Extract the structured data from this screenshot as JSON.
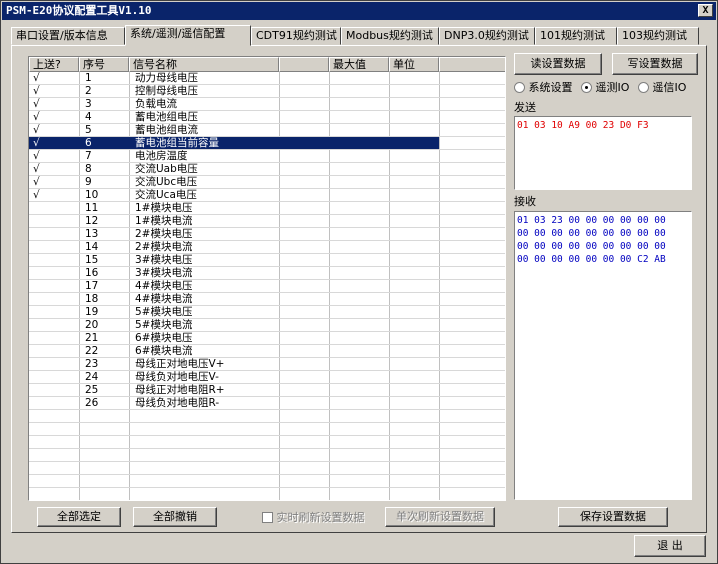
{
  "window": {
    "title": "PSM-E20协议配置工具V1.10",
    "close_label": "X"
  },
  "tabs": [
    {
      "label": "串口设置/版本信息"
    },
    {
      "label": "系统/遥测/遥信配置"
    },
    {
      "label": "CDT91规约测试"
    },
    {
      "label": "Modbus规约测试"
    },
    {
      "label": "DNP3.0规约测试"
    },
    {
      "label": "101规约测试"
    },
    {
      "label": "103规约测试"
    }
  ],
  "table": {
    "columns": [
      "上送?",
      "序号",
      "信号名称",
      "最大值",
      "单位"
    ],
    "rows": [
      {
        "sent": "√",
        "no": "1",
        "name": "动力母线电压"
      },
      {
        "sent": "√",
        "no": "2",
        "name": "控制母线电压"
      },
      {
        "sent": "√",
        "no": "3",
        "name": "负载电流"
      },
      {
        "sent": "√",
        "no": "4",
        "name": "蓄电池组电压"
      },
      {
        "sent": "√",
        "no": "5",
        "name": "蓄电池组电流"
      },
      {
        "sent": "√",
        "no": "6",
        "name": "蓄电池组当前容量"
      },
      {
        "sent": "√",
        "no": "7",
        "name": "电池房温度"
      },
      {
        "sent": "√",
        "no": "8",
        "name": "交流Uab电压"
      },
      {
        "sent": "√",
        "no": "9",
        "name": "交流Ubc电压"
      },
      {
        "sent": "√",
        "no": "10",
        "name": "交流Uca电压"
      },
      {
        "sent": "",
        "no": "11",
        "name": "1#模块电压"
      },
      {
        "sent": "",
        "no": "12",
        "name": "1#模块电流"
      },
      {
        "sent": "",
        "no": "13",
        "name": "2#模块电压"
      },
      {
        "sent": "",
        "no": "14",
        "name": "2#模块电流"
      },
      {
        "sent": "",
        "no": "15",
        "name": "3#模块电压"
      },
      {
        "sent": "",
        "no": "16",
        "name": "3#模块电流"
      },
      {
        "sent": "",
        "no": "17",
        "name": "4#模块电压"
      },
      {
        "sent": "",
        "no": "18",
        "name": "4#模块电流"
      },
      {
        "sent": "",
        "no": "19",
        "name": "5#模块电压"
      },
      {
        "sent": "",
        "no": "20",
        "name": "5#模块电流"
      },
      {
        "sent": "",
        "no": "21",
        "name": "6#模块电压"
      },
      {
        "sent": "",
        "no": "22",
        "name": "6#模块电流"
      },
      {
        "sent": "",
        "no": "23",
        "name": "母线正对地电压V+"
      },
      {
        "sent": "",
        "no": "24",
        "name": "母线负对地电压V-"
      },
      {
        "sent": "",
        "no": "25",
        "name": "母线正对地电阻R+"
      },
      {
        "sent": "",
        "no": "26",
        "name": "母线负对地电阻R-"
      }
    ],
    "selected_row": "6"
  },
  "buttons": {
    "read": "读设置数据",
    "write": "写设置数据",
    "select_all": "全部选定",
    "deselect_all": "全部撤销",
    "realtime_refresh": "实时刷新设置数据",
    "single_refresh": "单次刷新设置数据",
    "save": "保存设置数据",
    "exit": "退 出"
  },
  "radios": {
    "system": "系统设置",
    "telemetry": "遥测IO",
    "telesignal": "遥信IO",
    "selected": "telemetry"
  },
  "send": {
    "label": "发送",
    "text": "01 03 10 A9 00 23 D0 F3"
  },
  "receive": {
    "label": "接收",
    "lines": [
      "01 03 23 00 00 00 00 00 00",
      "00 00 00 00 00 00 00 00 00",
      "00 00 00 00 00 00 00 00 00",
      "00 00 00 00 00 00 00 C2 AB"
    ]
  },
  "colors": {
    "title_bg": "#0a246a",
    "send_text": "#e00000",
    "recv_text": "#0000c0"
  }
}
